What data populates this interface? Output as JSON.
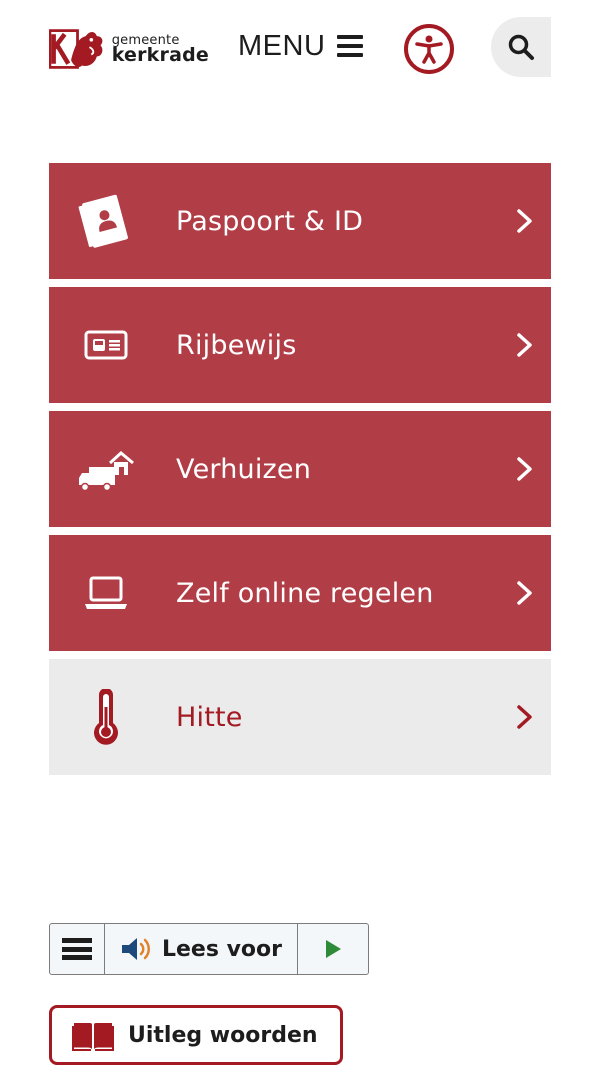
{
  "header": {
    "logo": {
      "small": "gemeente",
      "big": "kerkrade"
    },
    "menu_label": "MENU",
    "icons": {
      "menu": "hamburger-icon",
      "accessibility": "accessibility-icon",
      "search": "search-icon"
    },
    "colors": {
      "brand": "#a31a22",
      "tile": "#b13d46",
      "tile_light": "#ebebeb"
    }
  },
  "tiles": [
    {
      "label": "Paspoort & ID",
      "icon": "passport-icon",
      "style": "red"
    },
    {
      "label": "Rijbewijs",
      "icon": "drivers-license-icon",
      "style": "red"
    },
    {
      "label": "Verhuizen",
      "icon": "moving-truck-icon",
      "style": "red"
    },
    {
      "label": "Zelf online regelen",
      "icon": "laptop-icon",
      "style": "red"
    },
    {
      "label": "Hitte",
      "icon": "thermometer-icon",
      "style": "light"
    }
  ],
  "reader": {
    "label": "Lees voor",
    "icons": {
      "menu": "reader-menu-icon",
      "speaker": "speaker-icon",
      "play": "play-icon"
    }
  },
  "glossary": {
    "label": "Uitleg woorden",
    "icon": "book-icon"
  }
}
